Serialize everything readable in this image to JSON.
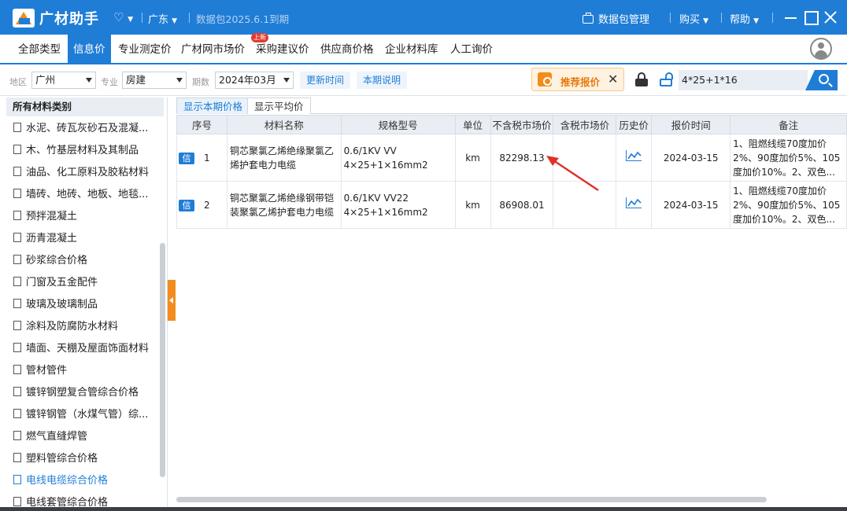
{
  "app": {
    "title": "广材助手",
    "region": "广东",
    "package_status": "数据包2025.6.1到期",
    "package_mgmt": "数据包管理",
    "buy": "购买",
    "help": "帮助"
  },
  "tabs": [
    {
      "label": "全部类型"
    },
    {
      "label": "信息价"
    },
    {
      "label": "专业测定价"
    },
    {
      "label": "广材网市场价"
    },
    {
      "label": "采购建议价",
      "badge": "上新"
    },
    {
      "label": "供应商价格"
    },
    {
      "label": "企业材料库"
    },
    {
      "label": "人工询价"
    }
  ],
  "filters": {
    "region_label": "地区",
    "region_value": "广州",
    "major_label": "专业",
    "major_value": "房建",
    "period_label": "期数",
    "period_value": "2024年03月",
    "update_time": "更新时间",
    "period_note": "本期说明",
    "recommend": "推荐报价",
    "search_value": "4*25+1*16"
  },
  "sidebar": {
    "header": "所有材料类别",
    "items": [
      "水泥、砖瓦灰砂石及混凝...",
      "木、竹基层材料及其制品",
      "油品、化工原料及胶粘材料",
      "墙砖、地砖、地板、地毯...",
      "预拌混凝土",
      "沥青混凝土",
      "砂浆综合价格",
      "门窗及五金配件",
      "玻璃及玻璃制品",
      "涂料及防腐防水材料",
      "墙面、天棚及屋面饰面材料",
      "管材管件",
      "镀锌钢塑复合管综合价格",
      "镀锌钢管（水煤气管）综...",
      "燃气直缝焊管",
      "塑料管综合价格",
      "电线电缆综合价格",
      "电线套管综合价格"
    ],
    "active_index": 16
  },
  "subtabs": [
    "显示本期价格",
    "显示平均价"
  ],
  "table": {
    "headers": [
      "序号",
      "材料名称",
      "规格型号",
      "单位",
      "不含税市场价",
      "含税市场价",
      "历史价",
      "报价时间",
      "备注"
    ],
    "tag": "信",
    "rows": [
      {
        "index": "1",
        "name": "铜芯聚氯乙烯绝缘聚氯乙烯护套电力电缆",
        "spec1": "0.6/1KV VV",
        "spec2": "4×25+1×16mm2",
        "unit": "km",
        "price_ex_tax": "82298.13",
        "price_inc_tax": "",
        "date": "2024-03-15",
        "remark": "1、阻燃线缆70度加价2%、90度加价5%、105度加价10%。2、双色..."
      },
      {
        "index": "2",
        "name": "铜芯聚氯乙烯绝缘钢带铠装聚氯乙烯护套电力电缆",
        "spec1": "0.6/1KV VV22",
        "spec2": "4×25+1×16mm2",
        "unit": "km",
        "price_ex_tax": "86908.01",
        "price_inc_tax": "",
        "date": "2024-03-15",
        "remark": "1、阻燃线缆70度加价2%、90度加价5%、105度加价10%。2、双色..."
      }
    ]
  },
  "colors": {
    "brand_blue": "#1f7dd6",
    "accent_orange": "#f28c1c",
    "arrow_red": "#e0302a"
  }
}
